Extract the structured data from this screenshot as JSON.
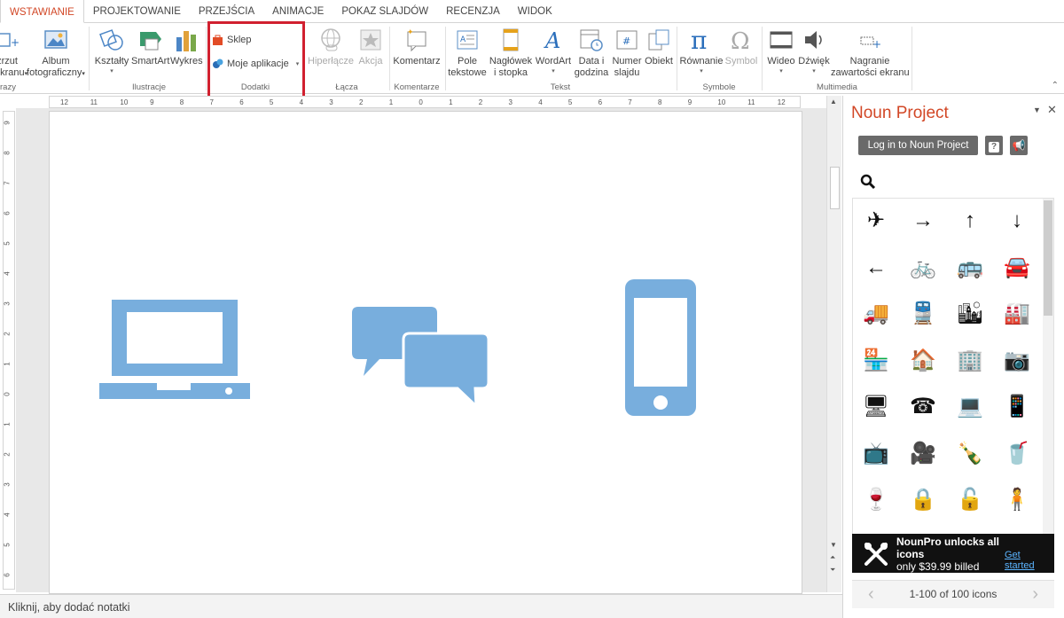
{
  "tabs": [
    {
      "label": "WSTAWIANIE",
      "active": true
    },
    {
      "label": "PROJEKTOWANIE"
    },
    {
      "label": "PRZEJŚCIA"
    },
    {
      "label": "ANIMACJE"
    },
    {
      "label": "POKAZ SLAJDÓW"
    },
    {
      "label": "RECENZJA"
    },
    {
      "label": "WIDOK"
    }
  ],
  "ribbon": {
    "images": {
      "zrzut_line1": "zrzut",
      "zrzut_line2": "ekranu",
      "group_label": "razy"
    },
    "album": {
      "line1": "Album",
      "line2": "fotograficzny"
    },
    "ilustracje": {
      "ksztalty": "Kształty",
      "smartart": "SmartArt",
      "wykres": "Wykres",
      "group_label": "Ilustracje"
    },
    "dodatki": {
      "sklep": "Sklep",
      "moje_aplikacje": "Moje aplikacje",
      "group_label": "Dodatki"
    },
    "lacza": {
      "hiperlacze": "Hiperłącze",
      "akcja": "Akcja",
      "group_label": "Łącza"
    },
    "komentarze": {
      "komentarz": "Komentarz",
      "group_label": "Komentarze"
    },
    "tekst": {
      "pole_line1": "Pole",
      "pole_line2": "tekstowe",
      "naglowek_line1": "Nagłówek",
      "naglowek_line2": "i stopka",
      "wordart": "WordArt",
      "data_line1": "Data i",
      "data_line2": "godzina",
      "numer_line1": "Numer",
      "numer_line2": "slajdu",
      "obiekt": "Obiekt",
      "group_label": "Tekst"
    },
    "symbole": {
      "rownanie": "Równanie",
      "symbol": "Symbol",
      "group_label": "Symbole"
    },
    "multimedia": {
      "wideo": "Wideo",
      "dzwiek": "Dźwięk",
      "nagranie_line1": "Nagranie",
      "nagranie_line2": "zawartości ekranu",
      "group_label": "Multimedia"
    }
  },
  "ruler": {
    "h_ticks": [
      "12",
      "11",
      "10",
      "9",
      "8",
      "7",
      "6",
      "5",
      "4",
      "3",
      "2",
      "1",
      "0",
      "1",
      "2",
      "3",
      "4",
      "5",
      "6",
      "7",
      "8",
      "9",
      "10",
      "11",
      "12"
    ],
    "v_ticks": [
      "9",
      "8",
      "7",
      "6",
      "5",
      "4",
      "3",
      "2",
      "1",
      "0",
      "1",
      "2",
      "3",
      "4",
      "5",
      "6"
    ]
  },
  "slide": {
    "accent": "#78aedd",
    "icons": [
      "laptop-icon",
      "chat-bubbles-icon",
      "smartphone-icon"
    ]
  },
  "notes": {
    "placeholder": "Kliknij, aby dodać notatki"
  },
  "pane": {
    "title": "Noun Project",
    "login_label": "Log in to Noun Project",
    "help_label": "?",
    "search_placeholder": "",
    "icons": [
      {
        "name": "airplane-icon",
        "glyph": "✈"
      },
      {
        "name": "arrow-right-icon",
        "glyph": "→"
      },
      {
        "name": "arrow-up-icon",
        "glyph": "↑"
      },
      {
        "name": "arrow-down-icon",
        "glyph": "↓"
      },
      {
        "name": "arrow-left-icon",
        "glyph": "←"
      },
      {
        "name": "bicycle-icon",
        "glyph": "🚲"
      },
      {
        "name": "bus-icon",
        "glyph": "🚌"
      },
      {
        "name": "car-icon",
        "glyph": "🚘"
      },
      {
        "name": "truck-icon",
        "glyph": "🚚"
      },
      {
        "name": "train-icon",
        "glyph": "🚆"
      },
      {
        "name": "city-icon",
        "glyph": "🏙"
      },
      {
        "name": "factory-icon",
        "glyph": "🏭"
      },
      {
        "name": "store-icon",
        "glyph": "🏪"
      },
      {
        "name": "house-icon",
        "glyph": "🏠"
      },
      {
        "name": "building-icon",
        "glyph": "🏢"
      },
      {
        "name": "camera-icon",
        "glyph": "📷"
      },
      {
        "name": "monitor-icon",
        "glyph": "🖥"
      },
      {
        "name": "telephone-icon",
        "glyph": "☎"
      },
      {
        "name": "laptop-icon",
        "glyph": "💻"
      },
      {
        "name": "mobile-phone-icon",
        "glyph": "📱"
      },
      {
        "name": "television-icon",
        "glyph": "📺"
      },
      {
        "name": "video-camera-icon",
        "glyph": "🎥"
      },
      {
        "name": "bottle-icon",
        "glyph": "🍾"
      },
      {
        "name": "cup-icon",
        "glyph": "🥤"
      },
      {
        "name": "wine-glass-icon",
        "glyph": "🍷"
      },
      {
        "name": "lock-icon",
        "glyph": "🔒"
      },
      {
        "name": "unlock-icon",
        "glyph": "🔓"
      },
      {
        "name": "person-icon",
        "glyph": "🧍"
      }
    ],
    "promo": {
      "line1": "NounPro unlocks all",
      "line2": "icons",
      "line3": "only $39.99 billed",
      "link": "Get started"
    },
    "pager_text": "1-100 of 100 icons"
  },
  "colors": {
    "accent": "#d24726",
    "highlight": "#d1202f"
  }
}
